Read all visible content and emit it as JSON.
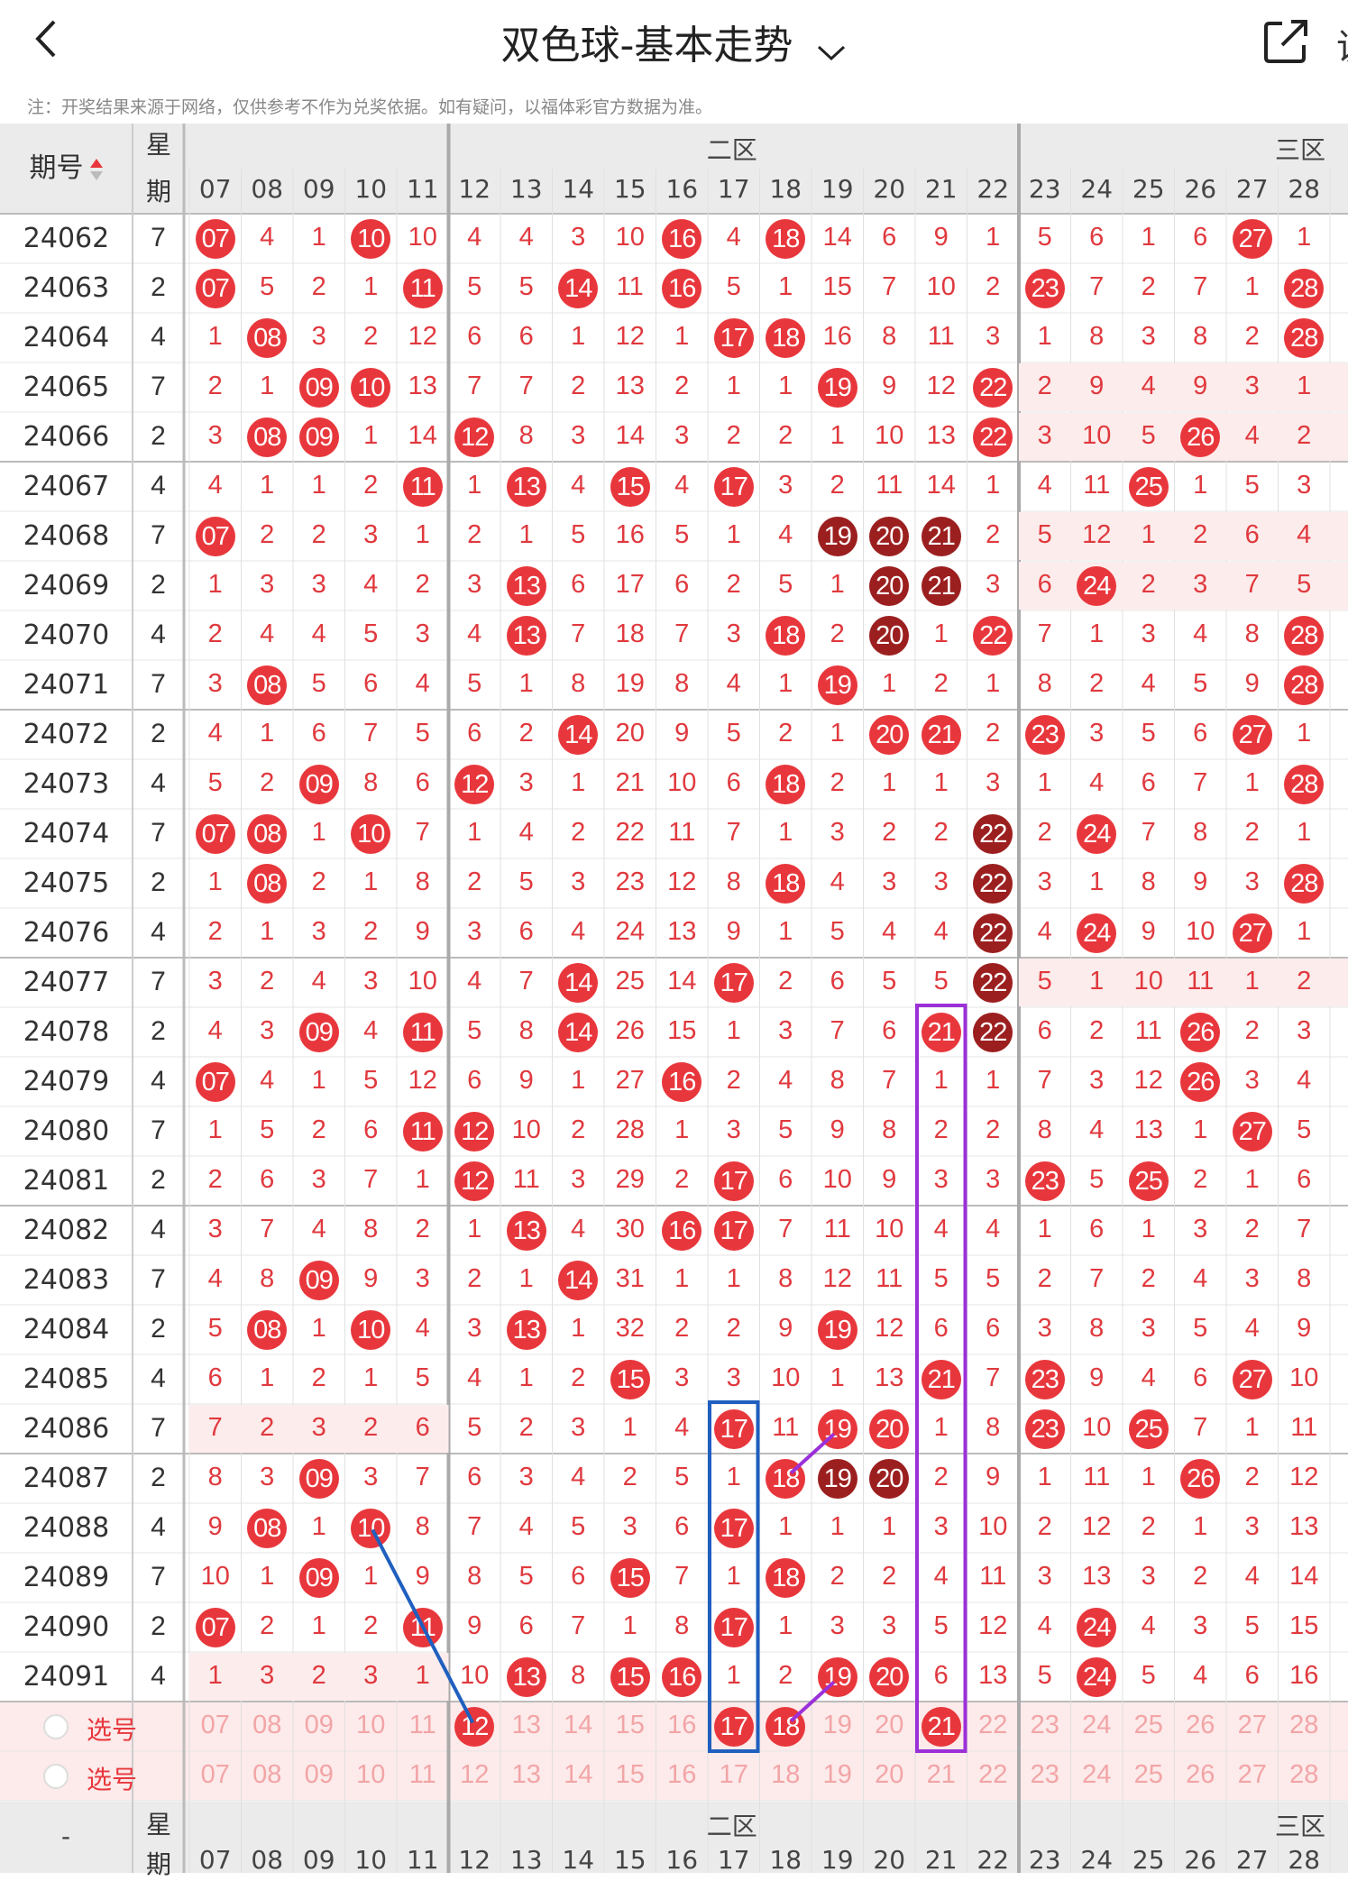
{
  "header": {
    "title": "双色球-基本走势",
    "note": "注：开奖结果来源于网络，仅供参考不作为兑奖依据。如有疑问，以福体彩官方数据为准。",
    "more_text": "说"
  },
  "table": {
    "issue_header": "期号",
    "weekday_header_top": "星",
    "weekday_header_bottom": "期",
    "zones": [
      "二区",
      "三区"
    ],
    "columns": [
      "07",
      "08",
      "09",
      "10",
      "11",
      "12",
      "13",
      "14",
      "15",
      "16",
      "17",
      "18",
      "19",
      "20",
      "21",
      "22",
      "23",
      "24",
      "25",
      "26",
      "27",
      "28"
    ],
    "rows": [
      {
        "issue": "24062",
        "weekday": "7",
        "values": [
          "07",
          "4",
          "1",
          "10",
          "10",
          "4",
          "4",
          "3",
          "10",
          "16",
          "4",
          "18",
          "14",
          "6",
          "9",
          "1",
          "5",
          "6",
          "1",
          "6",
          "27",
          "1"
        ]
      },
      {
        "issue": "24063",
        "weekday": "2",
        "values": [
          "07",
          "5",
          "2",
          "1",
          "11",
          "5",
          "5",
          "14",
          "11",
          "16",
          "5",
          "1",
          "15",
          "7",
          "10",
          "2",
          "23",
          "7",
          "2",
          "7",
          "1",
          "28"
        ]
      },
      {
        "issue": "24064",
        "weekday": "4",
        "values": [
          "1",
          "08",
          "3",
          "2",
          "12",
          "6",
          "6",
          "1",
          "12",
          "1",
          "17",
          "18",
          "16",
          "8",
          "11",
          "3",
          "1",
          "8",
          "3",
          "8",
          "2",
          "28"
        ]
      },
      {
        "issue": "24065",
        "weekday": "7",
        "values": [
          "2",
          "1",
          "09",
          "10",
          "13",
          "7",
          "7",
          "2",
          "13",
          "2",
          "1",
          "1",
          "19",
          "9",
          "12",
          "22",
          "2",
          "9",
          "4",
          "9",
          "3",
          "1"
        ]
      },
      {
        "issue": "24066",
        "weekday": "2",
        "values": [
          "3",
          "08",
          "09",
          "1",
          "14",
          "12",
          "8",
          "3",
          "14",
          "3",
          "2",
          "2",
          "1",
          "10",
          "13",
          "22",
          "3",
          "10",
          "5",
          "26",
          "4",
          "2"
        ]
      },
      {
        "issue": "24067",
        "weekday": "4",
        "values": [
          "4",
          "1",
          "1",
          "2",
          "11",
          "1",
          "13",
          "4",
          "15",
          "4",
          "17",
          "3",
          "2",
          "11",
          "14",
          "1",
          "4",
          "11",
          "25",
          "1",
          "5",
          "3"
        ]
      },
      {
        "issue": "24068",
        "weekday": "7",
        "values": [
          "07",
          "2",
          "2",
          "3",
          "1",
          "2",
          "1",
          "5",
          "16",
          "5",
          "1",
          "4",
          "19",
          "20",
          "21",
          "2",
          "5",
          "12",
          "1",
          "2",
          "6",
          "4"
        ]
      },
      {
        "issue": "24069",
        "weekday": "2",
        "values": [
          "1",
          "3",
          "3",
          "4",
          "2",
          "3",
          "13",
          "6",
          "17",
          "6",
          "2",
          "5",
          "1",
          "20",
          "21",
          "3",
          "6",
          "24",
          "2",
          "3",
          "7",
          "5"
        ]
      },
      {
        "issue": "24070",
        "weekday": "4",
        "values": [
          "2",
          "4",
          "4",
          "5",
          "3",
          "4",
          "13",
          "7",
          "18",
          "7",
          "3",
          "18",
          "2",
          "20",
          "1",
          "22",
          "7",
          "1",
          "3",
          "4",
          "8",
          "28"
        ]
      },
      {
        "issue": "24071",
        "weekday": "7",
        "values": [
          "3",
          "08",
          "5",
          "6",
          "4",
          "5",
          "1",
          "8",
          "19",
          "8",
          "4",
          "1",
          "19",
          "1",
          "2",
          "1",
          "8",
          "2",
          "4",
          "5",
          "9",
          "28"
        ]
      },
      {
        "issue": "24072",
        "weekday": "2",
        "values": [
          "4",
          "1",
          "6",
          "7",
          "5",
          "6",
          "2",
          "14",
          "20",
          "9",
          "5",
          "2",
          "1",
          "20",
          "21",
          "2",
          "23",
          "3",
          "5",
          "6",
          "27",
          "1"
        ]
      },
      {
        "issue": "24073",
        "weekday": "4",
        "values": [
          "5",
          "2",
          "09",
          "8",
          "6",
          "12",
          "3",
          "1",
          "21",
          "10",
          "6",
          "18",
          "2",
          "1",
          "1",
          "3",
          "1",
          "4",
          "6",
          "7",
          "1",
          "28"
        ]
      },
      {
        "issue": "24074",
        "weekday": "7",
        "values": [
          "07",
          "08",
          "1",
          "10",
          "7",
          "1",
          "4",
          "2",
          "22",
          "11",
          "7",
          "1",
          "3",
          "2",
          "2",
          "22",
          "2",
          "24",
          "7",
          "8",
          "2",
          "1"
        ]
      },
      {
        "issue": "24075",
        "weekday": "2",
        "values": [
          "1",
          "08",
          "2",
          "1",
          "8",
          "2",
          "5",
          "3",
          "23",
          "12",
          "8",
          "18",
          "4",
          "3",
          "3",
          "22",
          "3",
          "1",
          "8",
          "9",
          "3",
          "28"
        ]
      },
      {
        "issue": "24076",
        "weekday": "4",
        "values": [
          "2",
          "1",
          "3",
          "2",
          "9",
          "3",
          "6",
          "4",
          "24",
          "13",
          "9",
          "1",
          "5",
          "4",
          "4",
          "22",
          "4",
          "24",
          "9",
          "10",
          "27",
          "1"
        ]
      },
      {
        "issue": "24077",
        "weekday": "7",
        "values": [
          "3",
          "2",
          "4",
          "3",
          "10",
          "4",
          "7",
          "14",
          "25",
          "14",
          "17",
          "2",
          "6",
          "5",
          "5",
          "22",
          "5",
          "1",
          "10",
          "11",
          "1",
          "2"
        ]
      },
      {
        "issue": "24078",
        "weekday": "2",
        "values": [
          "4",
          "3",
          "09",
          "4",
          "11",
          "5",
          "8",
          "14",
          "26",
          "15",
          "1",
          "3",
          "7",
          "6",
          "21",
          "22",
          "6",
          "2",
          "11",
          "26",
          "2",
          "3"
        ]
      },
      {
        "issue": "24079",
        "weekday": "4",
        "values": [
          "07",
          "4",
          "1",
          "5",
          "12",
          "6",
          "9",
          "1",
          "27",
          "16",
          "2",
          "4",
          "8",
          "7",
          "1",
          "1",
          "7",
          "3",
          "12",
          "26",
          "3",
          "4"
        ]
      },
      {
        "issue": "24080",
        "weekday": "7",
        "values": [
          "1",
          "5",
          "2",
          "6",
          "11",
          "12",
          "10",
          "2",
          "28",
          "1",
          "3",
          "5",
          "9",
          "8",
          "2",
          "2",
          "8",
          "4",
          "13",
          "1",
          "27",
          "5"
        ]
      },
      {
        "issue": "24081",
        "weekday": "2",
        "values": [
          "2",
          "6",
          "3",
          "7",
          "1",
          "12",
          "11",
          "3",
          "29",
          "2",
          "17",
          "6",
          "10",
          "9",
          "3",
          "3",
          "23",
          "5",
          "25",
          "2",
          "1",
          "6"
        ]
      },
      {
        "issue": "24082",
        "weekday": "4",
        "values": [
          "3",
          "7",
          "4",
          "8",
          "2",
          "1",
          "13",
          "4",
          "30",
          "16",
          "17",
          "7",
          "11",
          "10",
          "4",
          "4",
          "1",
          "6",
          "1",
          "3",
          "2",
          "7"
        ]
      },
      {
        "issue": "24083",
        "weekday": "7",
        "values": [
          "4",
          "8",
          "09",
          "9",
          "3",
          "2",
          "1",
          "14",
          "31",
          "1",
          "1",
          "8",
          "12",
          "11",
          "5",
          "5",
          "2",
          "7",
          "2",
          "4",
          "3",
          "8"
        ]
      },
      {
        "issue": "24084",
        "weekday": "2",
        "values": [
          "5",
          "08",
          "1",
          "10",
          "4",
          "3",
          "13",
          "1",
          "32",
          "2",
          "2",
          "9",
          "19",
          "12",
          "6",
          "6",
          "3",
          "8",
          "3",
          "5",
          "4",
          "9"
        ]
      },
      {
        "issue": "24085",
        "weekday": "4",
        "values": [
          "6",
          "1",
          "2",
          "1",
          "5",
          "4",
          "1",
          "2",
          "15",
          "3",
          "3",
          "10",
          "1",
          "13",
          "21",
          "7",
          "23",
          "9",
          "4",
          "6",
          "27",
          "10"
        ]
      },
      {
        "issue": "24086",
        "weekday": "7",
        "values": [
          "7",
          "2",
          "3",
          "2",
          "6",
          "5",
          "2",
          "3",
          "1",
          "4",
          "17",
          "11",
          "19",
          "20",
          "1",
          "8",
          "23",
          "10",
          "25",
          "7",
          "1",
          "11"
        ]
      },
      {
        "issue": "24087",
        "weekday": "2",
        "values": [
          "8",
          "3",
          "09",
          "3",
          "7",
          "6",
          "3",
          "4",
          "2",
          "5",
          "1",
          "18",
          "19",
          "20",
          "2",
          "9",
          "1",
          "11",
          "1",
          "26",
          "2",
          "12"
        ]
      },
      {
        "issue": "24088",
        "weekday": "4",
        "values": [
          "9",
          "08",
          "1",
          "10",
          "8",
          "7",
          "4",
          "5",
          "3",
          "6",
          "17",
          "1",
          "1",
          "1",
          "3",
          "10",
          "2",
          "12",
          "2",
          "1",
          "3",
          "13"
        ]
      },
      {
        "issue": "24089",
        "weekday": "7",
        "values": [
          "10",
          "1",
          "09",
          "1",
          "9",
          "8",
          "5",
          "6",
          "15",
          "7",
          "1",
          "18",
          "2",
          "2",
          "4",
          "11",
          "3",
          "13",
          "3",
          "2",
          "4",
          "14"
        ]
      },
      {
        "issue": "24090",
        "weekday": "2",
        "values": [
          "07",
          "2",
          "1",
          "2",
          "11",
          "9",
          "6",
          "7",
          "1",
          "8",
          "17",
          "1",
          "3",
          "3",
          "5",
          "12",
          "4",
          "24",
          "4",
          "3",
          "5",
          "15"
        ]
      },
      {
        "issue": "24091",
        "weekday": "4",
        "values": [
          "1",
          "3",
          "2",
          "3",
          "1",
          "10",
          "13",
          "8",
          "15",
          "16",
          "1",
          "2",
          "19",
          "20",
          "6",
          "13",
          "5",
          "24",
          "5",
          "4",
          "6",
          "16"
        ]
      }
    ],
    "pick_rows": [
      {
        "label": "选号",
        "values": [
          "07",
          "08",
          "09",
          "10",
          "11",
          "12",
          "13",
          "14",
          "15",
          "16",
          "17",
          "18",
          "19",
          "20",
          "21",
          "22",
          "23",
          "24",
          "25",
          "26",
          "27",
          "28"
        ]
      },
      {
        "label": "选号",
        "values": [
          "07",
          "08",
          "09",
          "10",
          "11",
          "12",
          "13",
          "14",
          "15",
          "16",
          "17",
          "18",
          "19",
          "20",
          "21",
          "22",
          "23",
          "24",
          "25",
          "26",
          "27",
          "28"
        ]
      }
    ],
    "pick_selected": [
      "12",
      "17",
      "18",
      "21"
    ],
    "footer_issue": "-",
    "colors": {
      "ball": "#e8373c",
      "ball_dark": "#9c1f1f",
      "miss_text": "#e0393e",
      "pick_bg": "#fdeaea",
      "line_blue": "#1f5fbf",
      "line_purple": "#9b30d9"
    }
  }
}
